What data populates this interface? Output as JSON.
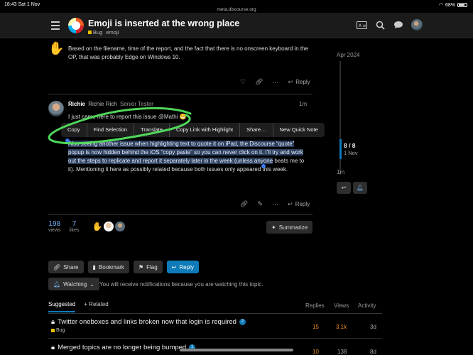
{
  "status_bar": {
    "time": "18:43  Sat 1 Nov",
    "url": "meta.discourse.org",
    "battery": "68%"
  },
  "header": {
    "title": "Emoji is inserted at the wrong place",
    "category": "Bug",
    "tag": "emoji"
  },
  "post1": {
    "body": "Based on the filename, time of the report, and the fact that there is no onscreen keyboard in the OP, that was probably Edge on Windows 10.",
    "reply_label": "Reply"
  },
  "post2": {
    "username": "Richie",
    "full_name": "Richie Rich",
    "user_title": "Senior Tester",
    "time": "1m",
    "line1_text": "I just came here to report this issue",
    "mention": "@Mathi",
    "body_highlighted": "Also seeing another issue when highlighting text to quote it on iPad, the Discourse “quote” popup is now hidden behind the iOS “copy paste” so you can never click on it. I’ll try and work out the steps to replicate and report it separately later in the week (unless anyone",
    "body_rest": " beats me to it). Mentioning it here as possibly related because both issues only appeared this week.",
    "reply_label": "Reply"
  },
  "context_menu": [
    "Copy",
    "Find Selection",
    "Translate",
    "Copy Link with Highlight",
    "Share…",
    "New Quick Note"
  ],
  "stats": {
    "views": "198",
    "views_label": "views",
    "likes": "7",
    "likes_label": "likes"
  },
  "summarize_label": "Summarize",
  "footer_buttons": {
    "share": "Share",
    "bookmark": "Bookmark",
    "flag": "Flag",
    "reply": "Reply"
  },
  "notifications": {
    "level": "Watching",
    "description": "You will receive notifications because you are watching this topic."
  },
  "suggested": {
    "tabs": [
      "Suggested",
      "Related"
    ],
    "columns": [
      "Replies",
      "Views",
      "Activity"
    ],
    "rows": [
      {
        "title": "Twitter oneboxes and links broken now that login is required",
        "badge": "2",
        "category": "Bug",
        "replies": "15",
        "views": "3.1k",
        "activity": "3d"
      },
      {
        "title": "Merged topics are no longer being bumped",
        "badge": "1",
        "category": "",
        "replies": "10",
        "views": "138",
        "activity": "8d"
      }
    ]
  },
  "timeline": {
    "top_date": "Apr 2024",
    "count": "8 / 8",
    "current_date": "1 Nov",
    "ago": "1m"
  },
  "colors": {
    "accent": "#0f7ab8",
    "highlight": "#2c3f5e",
    "annotation": "#4fd65a",
    "category_bug": "#e9c100"
  }
}
